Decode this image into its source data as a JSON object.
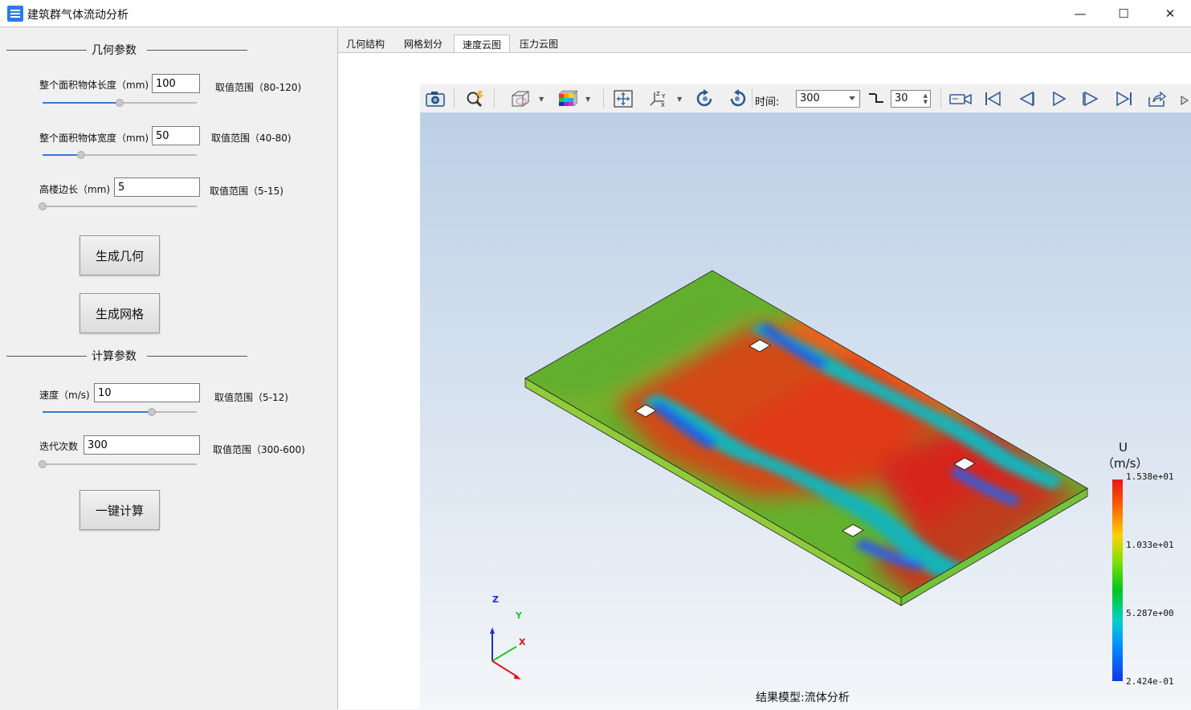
{
  "window": {
    "title": "建筑群气体流动分析",
    "icon": "app-icon",
    "controls": [
      "minimize-icon",
      "maximize-icon",
      "close-icon"
    ]
  },
  "geometry": {
    "header": "几何参数",
    "length": {
      "label": "整个面积物体长度（mm)",
      "value": "100",
      "range": "取值范围（80-120)",
      "slider_fraction": 0.5
    },
    "width": {
      "label": "整个面积物体宽度（mm)",
      "value": "50",
      "range": "取值范围（40-80)",
      "slider_fraction": 0.25
    },
    "building": {
      "label": "高楼边长（mm)",
      "value": "5",
      "range": "取值范围（5-15)",
      "slider_fraction": 0.0
    },
    "generate_geometry": "生成几何",
    "generate_mesh": "生成网格"
  },
  "calc": {
    "header": "计算参数",
    "speed": {
      "label": "速度（m/s)",
      "value": "10",
      "range": "取值范围（5-12)",
      "slider_fraction": 0.71
    },
    "iterations": {
      "label": "迭代次数",
      "value": "300",
      "range": "取值范围（300-600)",
      "slider_fraction": 0.0
    },
    "compute": "一键计算"
  },
  "tabs": [
    {
      "label": "几何结构",
      "active": false
    },
    {
      "label": "网格划分",
      "active": false
    },
    {
      "label": "速度云图",
      "active": true
    },
    {
      "label": "压力云图",
      "active": false
    }
  ],
  "toolbar": {
    "icons": [
      "camera-icon",
      "zoom-icon",
      "display-mode-icon",
      "colormap-icon",
      "fit-view-icon",
      "axes-icon",
      "rotate-cw-icon",
      "rotate-ccw-icon"
    ],
    "time_label": "时间:",
    "time_value": "300",
    "step_value": "30",
    "playback": [
      "record-icon",
      "first-frame-icon",
      "prev-frame-icon",
      "play-icon",
      "next-frame-icon",
      "last-frame-icon",
      "export-icon"
    ]
  },
  "colorbar": {
    "title": "U",
    "unit": "（m/s）",
    "ticks": [
      "1.538e+01",
      "1.033e+01",
      "5.287e+00",
      "2.424e-01"
    ],
    "colors": [
      "#e8161b",
      "#fdd200",
      "#00c81e",
      "#00d1c9",
      "#1437e6"
    ]
  },
  "triad": {
    "x": "X",
    "y": "Y",
    "z": "Z"
  },
  "caption": "结果模型:流体分析"
}
